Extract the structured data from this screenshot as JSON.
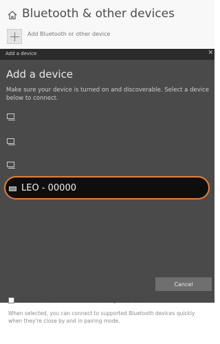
{
  "settings": {
    "title": "Bluetooth & other devices",
    "add_device_label": "Add Bluetooth or other device"
  },
  "dialog": {
    "titlebar": "Add a device",
    "heading": "Add a device",
    "description": "Make sure your device is turned on and discoverable. Select a device below to connect.",
    "selected_device": "LEO - 00000",
    "cancel_label": "Cancel"
  },
  "swift_pair": {
    "label": "Show notifications to connect using Swift Pair",
    "note": "When selected, you can connect to supported Bluetooth devices quickly when they're close by and in pairing mode."
  },
  "colors": {
    "dialog_bg": "#4a4a4a",
    "highlight_ring": "#e8803a"
  }
}
